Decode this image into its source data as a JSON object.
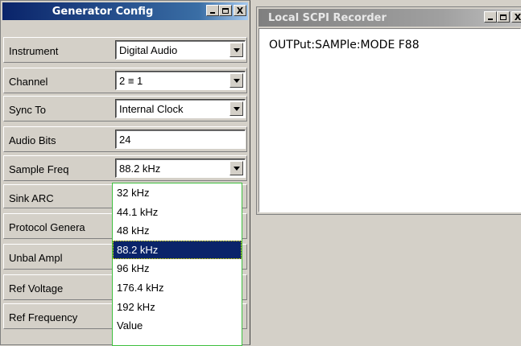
{
  "generator": {
    "title": "Generator Config",
    "rows": [
      {
        "label": "Instrument",
        "value": "Digital Audio",
        "dropdown": true
      },
      {
        "label": "Channel",
        "value": "2 ≡ 1",
        "dropdown": true
      },
      {
        "label": "Sync To",
        "value": "Internal Clock",
        "dropdown": true
      },
      {
        "label": "Audio Bits",
        "value": "24",
        "dropdown": false
      },
      {
        "label": "Sample Freq",
        "value": "88.2 kHz",
        "dropdown": true
      },
      {
        "label": "Sink ARC",
        "value": "",
        "dropdown": false
      },
      {
        "label": "Protocol Genera",
        "value": "",
        "dropdown": false
      },
      {
        "label": "Unbal Ampl",
        "value": "",
        "dropdown": false
      },
      {
        "label": "Ref Voltage",
        "value": "",
        "dropdown": false
      },
      {
        "label": "Ref Frequency",
        "value": "",
        "dropdown": false
      }
    ],
    "sample_freq_options": [
      "32 kHz",
      "44.1 kHz",
      "48 kHz",
      "88.2 kHz",
      "96 kHz",
      "176.4 kHz",
      "192 kHz",
      "Value"
    ],
    "selected_option": "88.2 kHz"
  },
  "recorder": {
    "title": "Local SCPI Recorder",
    "text": "OUTPut:SAMPle:MODE F88"
  },
  "titlebar_buttons": {
    "minimize": "_",
    "maximize": "□",
    "close": "X"
  }
}
